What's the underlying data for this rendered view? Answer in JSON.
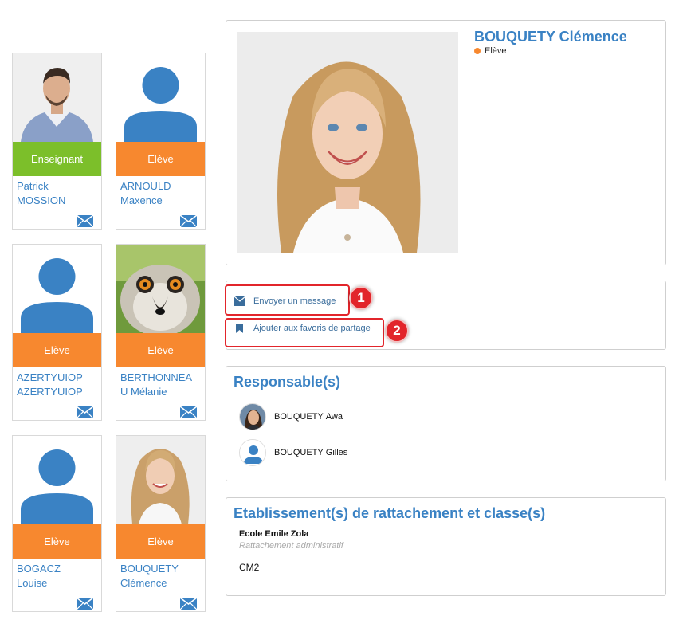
{
  "people": [
    {
      "role": "Enseignant",
      "first": "Patrick",
      "last": "MOSSION"
    },
    {
      "role": "Elève",
      "first": "ARNOULD",
      "last": "Maxence"
    },
    {
      "role": "Elève",
      "first": "AZERTYUIOP",
      "last": "AZERTYUIOP"
    },
    {
      "role": "Elève",
      "first": "BERTHONNEA",
      "last": "U Mélanie"
    },
    {
      "role": "Elève",
      "first": "BOGACZ",
      "last": "Louise"
    },
    {
      "role": "Elève",
      "first": "BOUQUETY",
      "last": "Clémence"
    }
  ],
  "profile": {
    "name": "BOUQUETY Clémence",
    "role": "Elève"
  },
  "actions": {
    "send_message": "Envoyer un message",
    "add_favorite": "Ajouter aux favoris de partage",
    "badge1": "1",
    "badge2": "2"
  },
  "responsables": {
    "title": "Responsable(s)",
    "items": [
      {
        "name_upper": "BOUQUETY",
        "name_first": "Awa"
      },
      {
        "name_upper": "BOUQUETY",
        "name_first": "Gilles"
      }
    ]
  },
  "etablissement": {
    "title": "Etablissement(s) de rattachement et classe(s)",
    "school": "Ecole Emile Zola",
    "type": "Rattachement administratif",
    "class": "CM2"
  },
  "colors": {
    "accent": "#3a82c4",
    "teacher": "#7cbf2a",
    "student": "#f7882f",
    "highlight": "#e2252b"
  }
}
